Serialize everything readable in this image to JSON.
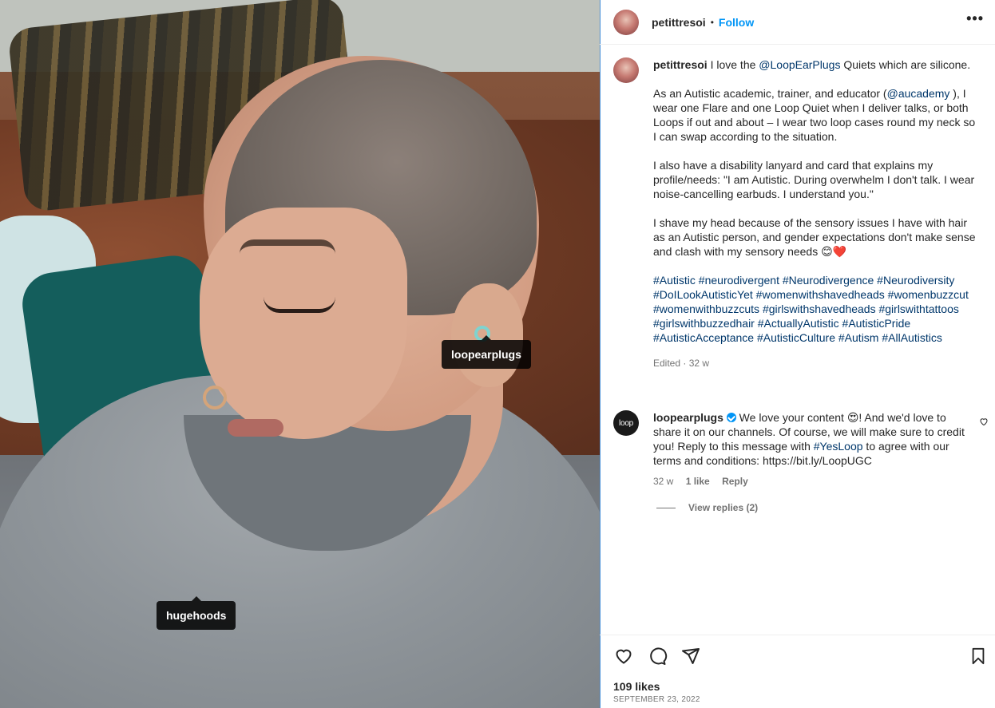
{
  "post": {
    "author": "petittresoi",
    "follow_label": "Follow",
    "header_dot": "•",
    "more_label": "•••",
    "photo_tags": [
      {
        "label": "loopearplugs"
      },
      {
        "label": "hugehoods"
      }
    ]
  },
  "caption": {
    "author": "petittresoi",
    "p1_pre": " I love the ",
    "p1_mention": "@LoopEarPlugs",
    "p1_post": " Quiets which are silicone.",
    "p2_pre": "As an Autistic academic, trainer, and educator (",
    "p2_mention": "@aucademy",
    "p2_post": " ), I wear one Flare and one Loop Quiet when I deliver talks, or both Loops if out and about – I wear two loop cases round my neck so I can swap according to the situation.",
    "p3": "I also have a disability lanyard and card that explains my profile/needs: \"I am Autistic. During overwhelm I don't talk. I wear noise-cancelling earbuds. I understand you.\"",
    "p4": "I shave my head because of the sensory issues I have with hair as an Autistic person, and gender expectations don't make sense and clash with my sensory needs 😊❤️",
    "hashtags": "#Autistic #neurodivergent #Neurodivergence #Neurodiversity #DoILookAutisticYet #womenwithshavedheads #womenbuzzcut #womenwithbuzzcuts #girlswithshavedheads #girlswithtattoos #girlswithbuzzedhair #ActuallyAutistic #AutisticPride #AutisticAcceptance #AutisticCulture #Autism #AllAutistics",
    "meta": "Edited · 32 w"
  },
  "reply": {
    "avatar_text": "loop",
    "author": "loopearplugs",
    "text_pre": " We love your content 😍! And we'd love to share it on our channels. Of course, we will make sure to credit you! Reply to this message with ",
    "hashtag": "#YesLoop",
    "text_post": " to agree with our terms and conditions: https://bit.ly/LoopUGC",
    "time": "32 w",
    "likes": "1 like",
    "reply_label": "Reply",
    "view_replies": "View replies (2)"
  },
  "footer": {
    "likes": "109 likes",
    "date": "SEPTEMBER 23, 2022"
  },
  "icons": [
    "heart-icon",
    "comment-icon",
    "share-icon",
    "bookmark-icon",
    "more-icon",
    "verified-icon"
  ],
  "colors": {
    "link": "#00376b",
    "follow": "#0095f6",
    "muted": "#737373"
  }
}
